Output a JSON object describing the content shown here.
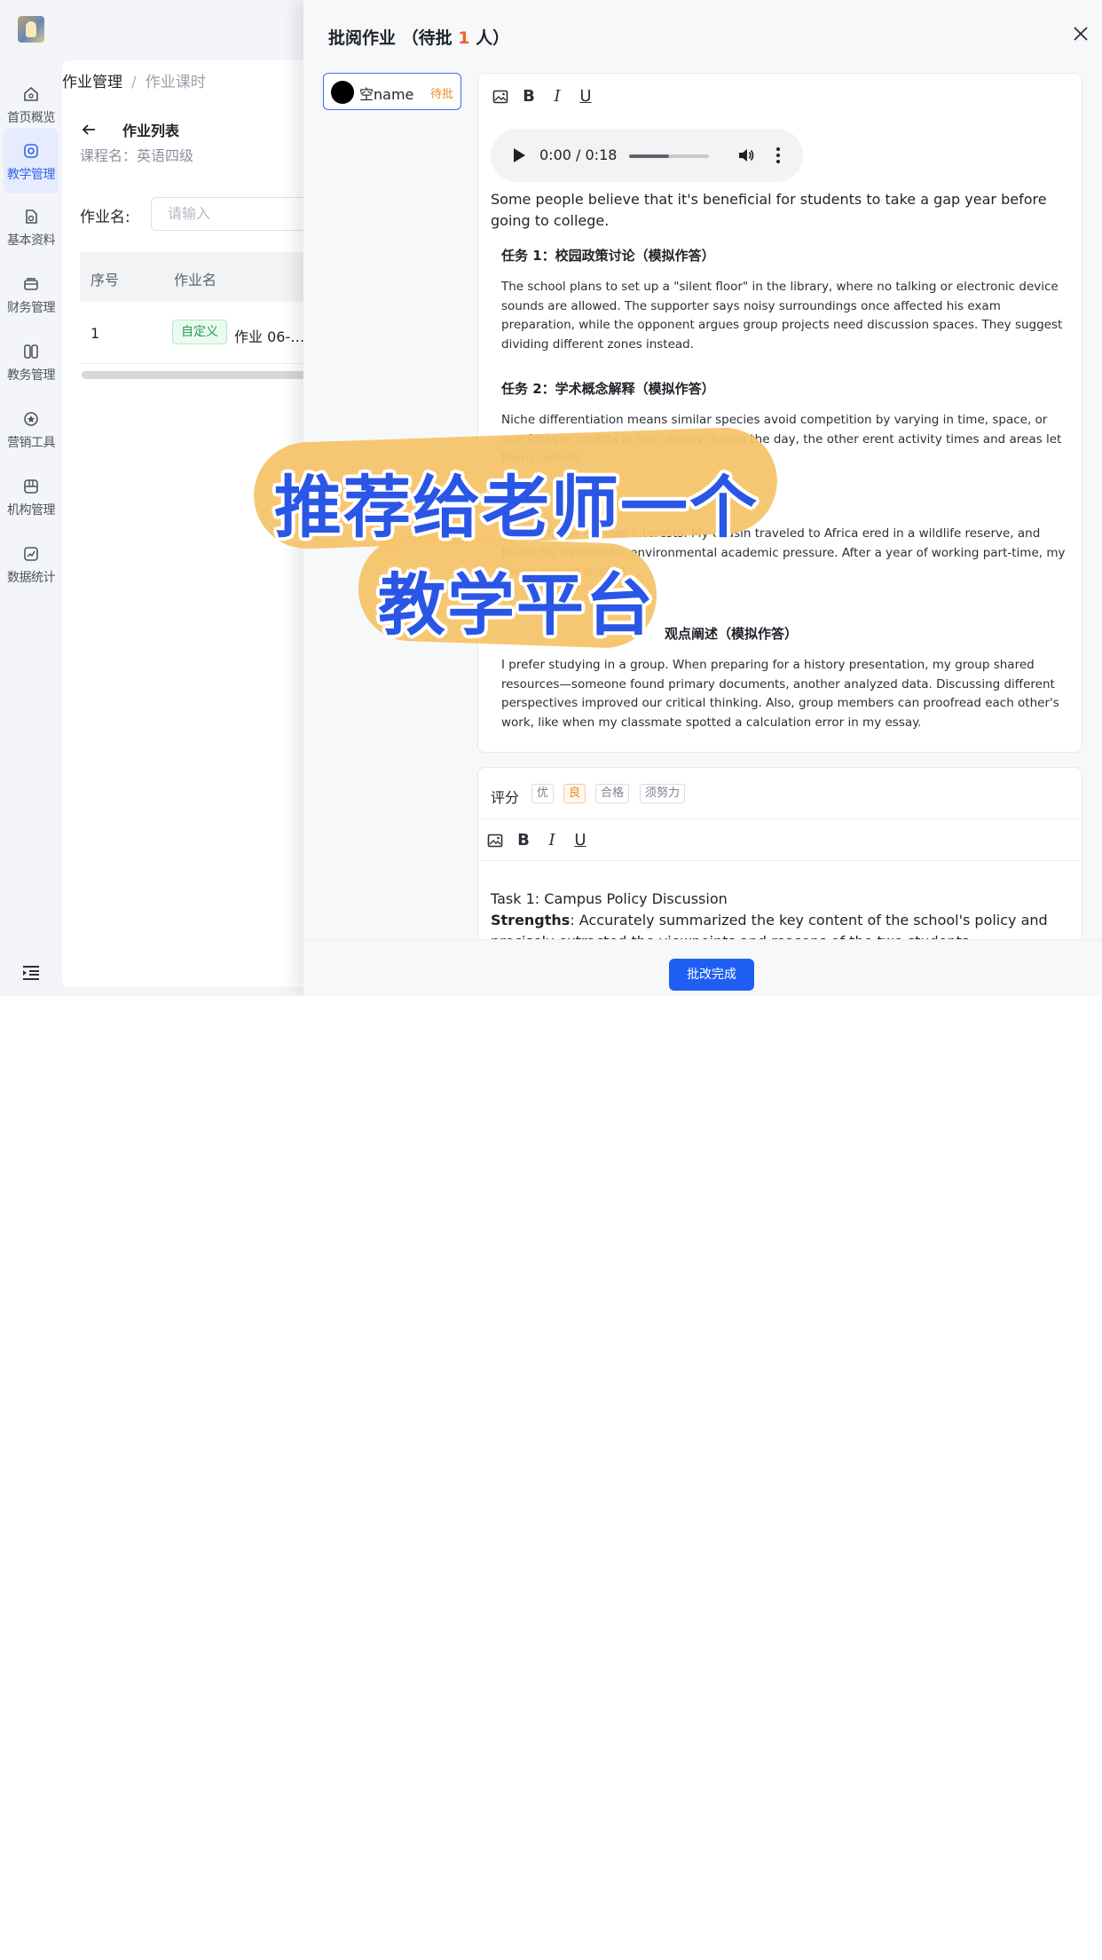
{
  "nav": {
    "items": [
      {
        "label": "首页概览",
        "icon": "home-icon"
      },
      {
        "label": "教学管理",
        "icon": "teaching-icon",
        "active": true
      },
      {
        "label": "基本资料",
        "icon": "profile-icon"
      },
      {
        "label": "财务管理",
        "icon": "finance-icon"
      },
      {
        "label": "教务管理",
        "icon": "academic-icon"
      },
      {
        "label": "营销工具",
        "icon": "marketing-icon"
      },
      {
        "label": "机构管理",
        "icon": "organization-icon"
      },
      {
        "label": "数据统计",
        "icon": "statistics-icon"
      }
    ]
  },
  "breadcrumb": {
    "parent": "作业管理",
    "separator": "/",
    "current": "作业课时"
  },
  "list": {
    "title": "作业列表",
    "course_label": "课程名：英语四级",
    "filter_label": "作业名:",
    "filter_placeholder": "请输入",
    "columns": [
      "序号",
      "作业名"
    ],
    "rows": [
      {
        "index": "1",
        "tag": "自定义",
        "name": "作业 06-…"
      }
    ]
  },
  "drawer": {
    "title_prefix": "批阅作业 （待批 ",
    "pending_count": "1",
    "title_suffix": " 人）",
    "student": {
      "name": "空name",
      "status": "待批"
    },
    "audio": {
      "time": "0:00 / 0:18",
      "progress": 0.5
    },
    "question": "Some people believe that it's beneficial for students to take a gap year before going to college.",
    "tasks": [
      {
        "heading": "任务 1：校园政策讨论（模拟作答）",
        "body": "The school plans to set up a \"silent floor\" in the library, where no talking or electronic device sounds are allowed. The supporter says noisy surroundings once affected his exam preparation, while the opponent argues group projects need discussion spaces. They suggest dividing different zones instead."
      },
      {
        "heading": "任务 2：学术概念解释（模拟作答）",
        "body": "Niche differentiation means similar species avoid competition by varying in time, space, or one forages insects in the canopy during the day, the other erent activity times and areas let them coexist."
      },
      {
        "heading": "",
        "body": "rstly, it helps explore interests. My cousin traveled to Africa ered in a wildlife reserve, and found his passion for environmental academic pressure. After a year of working part-time, my friend sed on studies."
      },
      {
        "heading": "观点阐述（模拟作答）",
        "body": "I prefer studying in a group. When preparing for a history presentation, my group shared resources—someone found primary documents, another analyzed data. Discussing different perspectives improved our critical thinking. Also, group members can proofread each other's work, like when my classmate spotted a calculation error in my essay."
      }
    ],
    "grading": {
      "label": "评分",
      "options": [
        "优",
        "良",
        "合格",
        "须努力"
      ],
      "selected": "良"
    },
    "comment": {
      "line1": "Task 1: Campus Policy Discussion",
      "strengths_label": "Strengths",
      "strengths_text": ": Accurately summarized the key content of the school's policy and precisely extracted the viewpoints and reasons of the two students, demonstrating high information"
    },
    "submit_label": "批改完成"
  },
  "caption": {
    "line1": "推荐给老师一个",
    "line2": "教学平台"
  },
  "colors": {
    "primary": "#1f5ef2",
    "accent_orange": "#f08a24",
    "caption_blue": "#2a56e6",
    "caption_bg": "#f5c46c"
  }
}
